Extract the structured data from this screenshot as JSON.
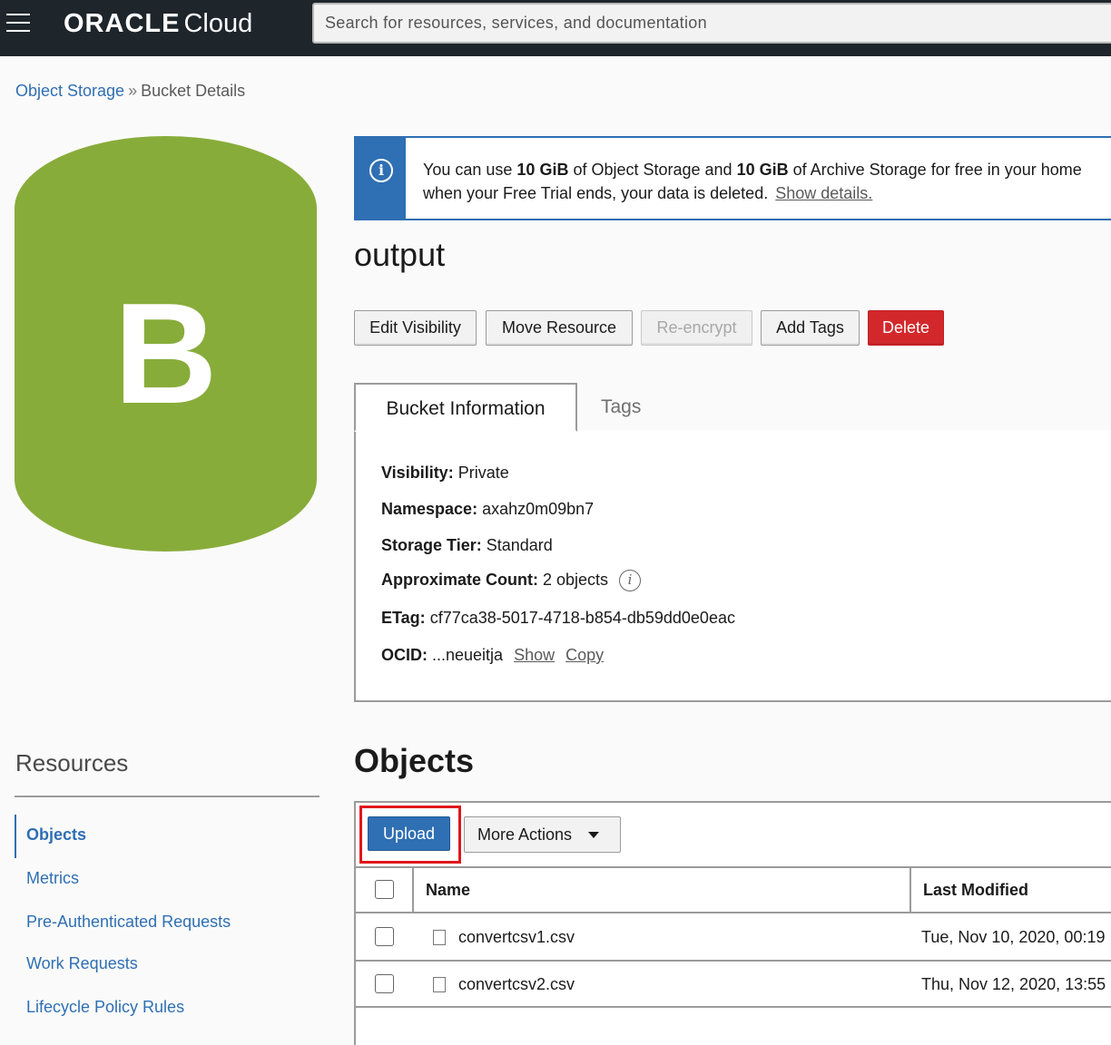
{
  "topbar": {
    "brand_oracle": "ORACLE",
    "brand_cloud": "Cloud",
    "search_placeholder": "Search for resources, services, and documentation"
  },
  "breadcrumb": {
    "parent": "Object Storage",
    "separator": "»",
    "current": "Bucket Details"
  },
  "bucket_icon": {
    "letter": "B",
    "color": "#88ac3a"
  },
  "banner": {
    "text_1": "You can use ",
    "amount_1": "10 GiB",
    "text_2": " of Object Storage and ",
    "amount_2": "10 GiB",
    "text_3": " of Archive Storage for free in your home",
    "text_4": "when your Free Trial ends, your data is deleted.",
    "link": "Show details."
  },
  "bucket": {
    "name": "output"
  },
  "actions": {
    "edit_visibility": "Edit Visibility",
    "move_resource": "Move Resource",
    "re_encrypt": "Re-encrypt",
    "add_tags": "Add Tags",
    "delete": "Delete"
  },
  "tabs": {
    "bucket_information": "Bucket Information",
    "tags": "Tags"
  },
  "info": {
    "visibility_label": "Visibility:",
    "visibility_value": "Private",
    "namespace_label": "Namespace:",
    "namespace_value": "axahz0m09bn7",
    "tier_label": "Storage Tier:",
    "tier_value": "Standard",
    "count_label": "Approximate Count:",
    "count_value": "2 objects",
    "etag_label": "ETag:",
    "etag_value": "cf77ca38-5017-4718-b854-db59dd0e0eac",
    "ocid_label": "OCID:",
    "ocid_value": "...neueitja",
    "ocid_show": "Show",
    "ocid_copy": "Copy"
  },
  "resources": {
    "title": "Resources",
    "items": [
      {
        "label": "Objects"
      },
      {
        "label": "Metrics"
      },
      {
        "label": "Pre-Authenticated Requests"
      },
      {
        "label": "Work Requests"
      },
      {
        "label": "Lifecycle Policy Rules"
      }
    ]
  },
  "objects": {
    "title": "Objects",
    "upload": "Upload",
    "more_actions": "More Actions",
    "columns": {
      "name": "Name",
      "last_modified": "Last Modified"
    },
    "rows": [
      {
        "name": "convertcsv1.csv",
        "modified": "Tue, Nov 10, 2020, 00:19"
      },
      {
        "name": "convertcsv2.csv",
        "modified": "Thu, Nov 12, 2020, 13:55"
      }
    ]
  },
  "colors": {
    "accent": "#2f6fb3",
    "danger": "#d2282c",
    "topbar": "#1e252b",
    "highlight": "#e0161b"
  }
}
